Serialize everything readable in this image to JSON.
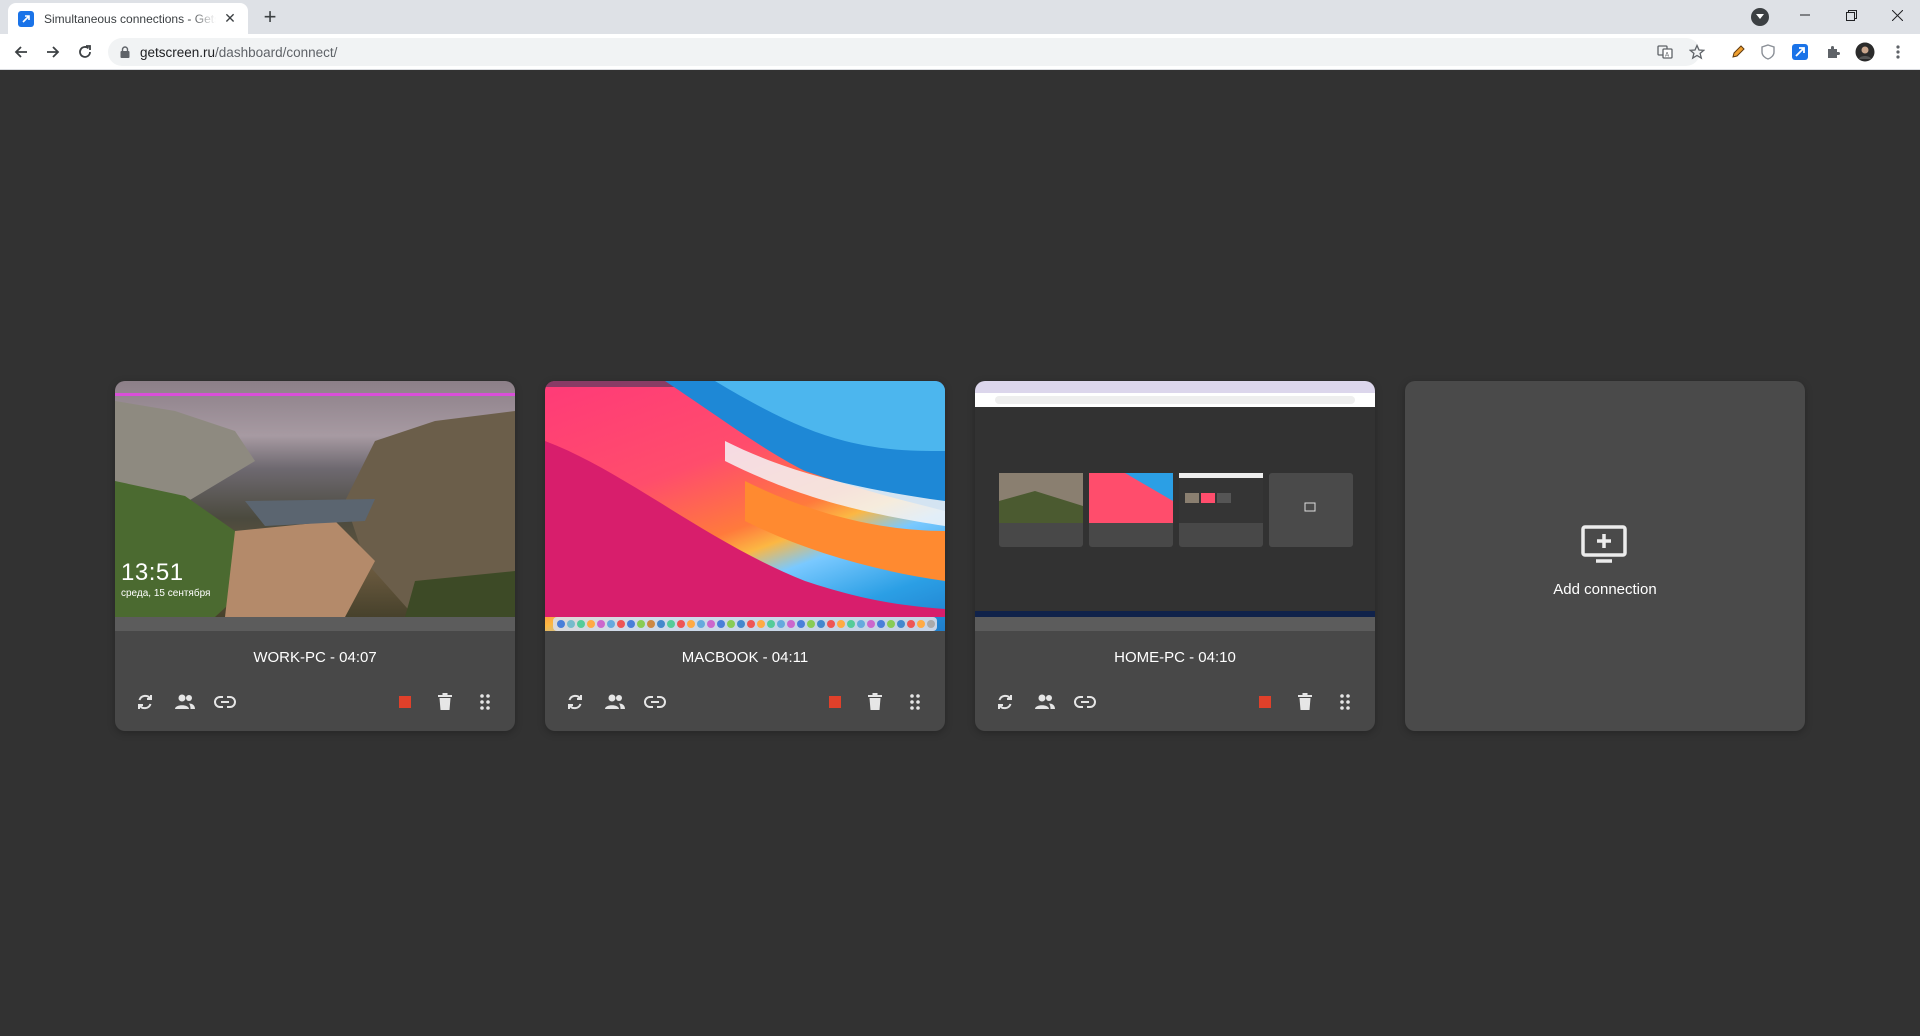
{
  "browser": {
    "tab_title": "Simultaneous connections - Getscreen",
    "url_host": "getscreen.ru",
    "url_path": "/dashboard/connect/"
  },
  "connections": [
    {
      "name": "WORK-PC",
      "time": "04:07",
      "title": "WORK-PC - 04:07",
      "lock_time": "13:51",
      "lock_date": "среда, 15 сентября"
    },
    {
      "name": "MACBOOK",
      "time": "04:11",
      "title": "MACBOOK - 04:11"
    },
    {
      "name": "HOME-PC",
      "time": "04:10",
      "title": "HOME-PC - 04:10"
    }
  ],
  "add_connection": {
    "label": "Add connection"
  },
  "colors": {
    "page_bg": "#323232",
    "card_bg": "#484848",
    "stop_red": "#e0402a",
    "icon_light": "#e6e6e6"
  },
  "icons": [
    "refresh-icon",
    "users-icon",
    "link-icon",
    "stop-icon",
    "trash-icon",
    "drag-handle-icon",
    "add-monitor-icon"
  ]
}
